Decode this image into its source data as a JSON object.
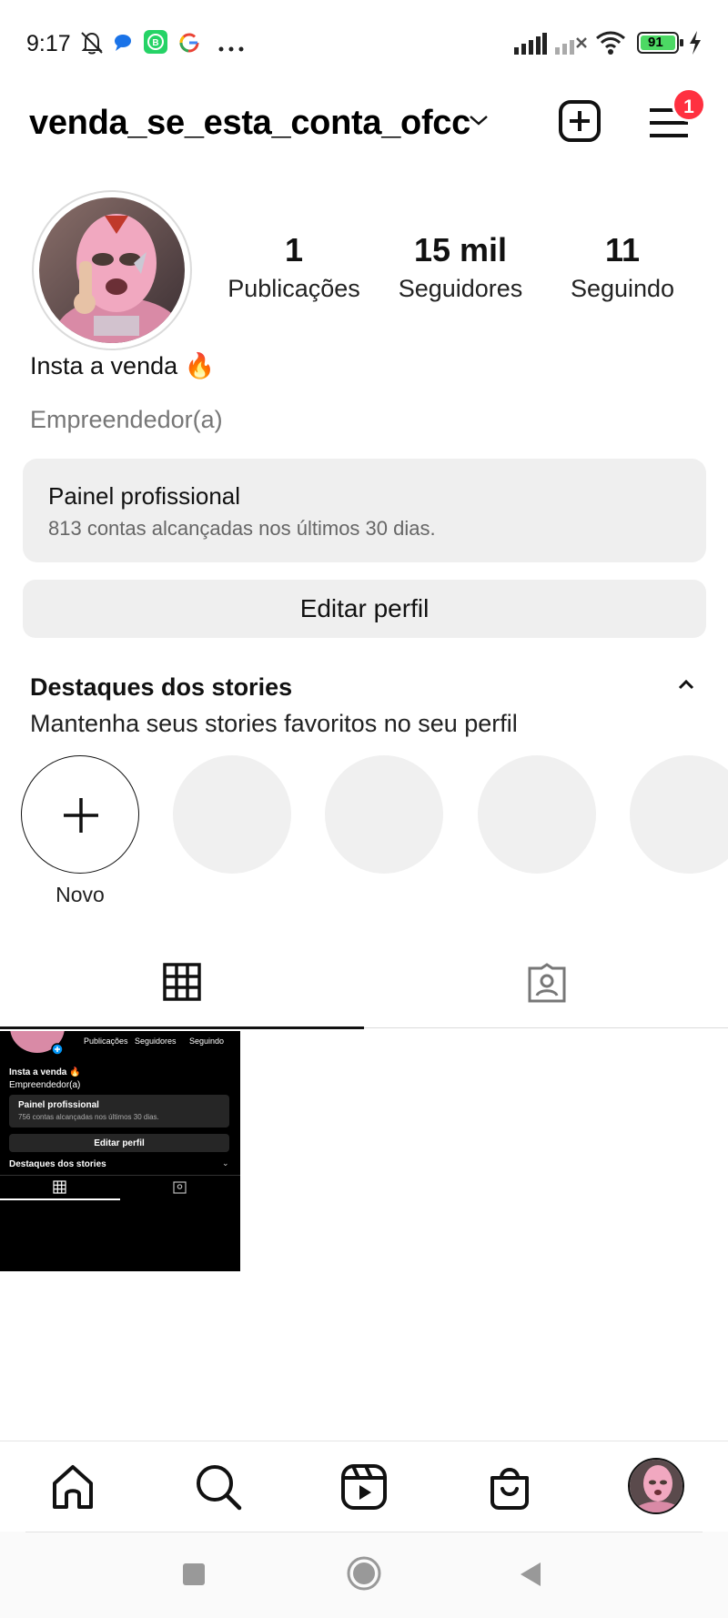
{
  "status_bar": {
    "time": "9:17",
    "battery": "91",
    "icons": [
      "bell-off-icon",
      "message-icon",
      "whatsapp-business-icon",
      "google-icon",
      "more-icon",
      "signal-icon",
      "signal-no-service-icon",
      "wifi-icon",
      "battery-icon",
      "charging-icon"
    ]
  },
  "header": {
    "username": "venda_se_esta_conta_ofcc",
    "notification_count": "1",
    "icons": [
      "chevron-down-icon",
      "new-post-icon",
      "menu-icon"
    ]
  },
  "profile": {
    "stats": [
      {
        "value": "1",
        "label": "Publicações"
      },
      {
        "value": "15 mil",
        "label": "Seguidores"
      },
      {
        "value": "11",
        "label": "Seguindo"
      }
    ],
    "name": "Insta a venda 🔥",
    "category": "Empreendedor(a)"
  },
  "professional_panel": {
    "title": "Painel profissional",
    "subtitle": "813 contas alcançadas nos últimos 30 dias."
  },
  "edit_profile_label": "Editar perfil",
  "highlights": {
    "title": "Destaques dos stories",
    "subtitle": "Mantenha seus stories favoritos no seu perfil",
    "new_label": "Novo"
  },
  "tabs": [
    "grid-icon",
    "tagged-icon"
  ],
  "post_thumbnail": {
    "stats_labels": [
      "Publicações",
      "Seguidores",
      "Seguindo"
    ],
    "name": "Insta a venda 🔥",
    "category": "Empreendedor(a)",
    "panel_title": "Painel profissional",
    "panel_subtitle": "756 contas alcançadas nos últimos 30 dias.",
    "edit_label": "Editar perfil",
    "highlights_title": "Destaques dos stories"
  },
  "bottom_nav": [
    "home-icon",
    "search-icon",
    "reels-icon",
    "shop-icon",
    "profile-avatar"
  ],
  "colors": {
    "badge": "#ff3040",
    "panel_bg": "#efefef",
    "text": "#111111",
    "muted": "#777777"
  }
}
